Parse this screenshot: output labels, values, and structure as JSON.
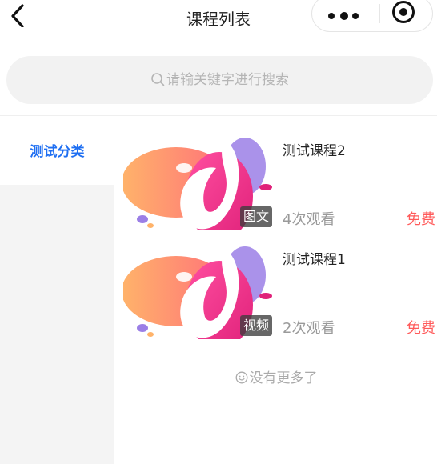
{
  "header": {
    "title": "课程列表"
  },
  "search": {
    "placeholder": "请输关键字进行搜索"
  },
  "categories": [
    {
      "label": "测试分类",
      "active": true
    }
  ],
  "courses": [
    {
      "name": "测试课程2",
      "type_badge": "图文",
      "views": "4次观看",
      "price": "免费"
    },
    {
      "name": "测试课程1",
      "type_badge": "视频",
      "views": "2次观看",
      "price": "免费"
    }
  ],
  "list_end_text": "没有更多了",
  "colors": {
    "accent": "#1f6ff2",
    "price": "#ff5a5a",
    "muted": "#9a9a9a",
    "sidebar_bg": "#f4f4f4",
    "search_bg": "#f2f2f2"
  },
  "icons": {
    "back": "chevron-left-icon",
    "menu": "more-dots-icon",
    "close": "target-close-icon",
    "search": "search-icon",
    "end": "smile-icon"
  }
}
